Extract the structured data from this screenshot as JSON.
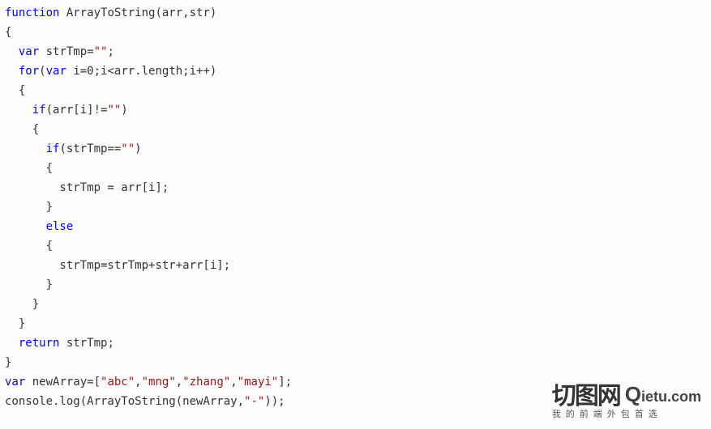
{
  "code": {
    "l1a": "function",
    "l1b": " ArrayToString(arr,str)",
    "l2": "{",
    "l3a": "  ",
    "l3b": "var",
    "l3c": " strTmp=",
    "l3d": "\"\"",
    "l3e": ";",
    "l4a": "  ",
    "l4b": "for",
    "l4c": "(",
    "l4d": "var",
    "l4e": " i=0;i<arr.length;i++)",
    "l5": "  {",
    "l6a": "    ",
    "l6b": "if",
    "l6c": "(arr[i]!=",
    "l6d": "\"\"",
    "l6e": ")",
    "l7": "    {",
    "l8a": "      ",
    "l8b": "if",
    "l8c": "(strTmp==",
    "l8d": "\"\"",
    "l8e": ")",
    "l9": "      {",
    "l10": "        strTmp = arr[i];",
    "l11": "      }",
    "l12a": "      ",
    "l12b": "else",
    "l13": "      {",
    "l14": "        strTmp=strTmp+str+arr[i];",
    "l15": "      }",
    "l16": "    }",
    "l17": "  }",
    "l18a": "  ",
    "l18b": "return",
    "l18c": " strTmp;",
    "l19": "}",
    "l20a": "var",
    "l20b": " newArray=[",
    "l20c": "\"abc\"",
    "l20d": ",",
    "l20e": "\"mng\"",
    "l20f": ",",
    "l20g": "\"zhang\"",
    "l20h": ",",
    "l20i": "\"mayi\"",
    "l20j": "];",
    "l21a": "console.log(ArrayToString(newArray,",
    "l21b": "\"-\"",
    "l21c": "));"
  },
  "watermark": {
    "cn": "切图网",
    "brand_q": "Q",
    "brand_rest": "ietu",
    "tld": ".com",
    "sub": "我的前端外包首选"
  }
}
